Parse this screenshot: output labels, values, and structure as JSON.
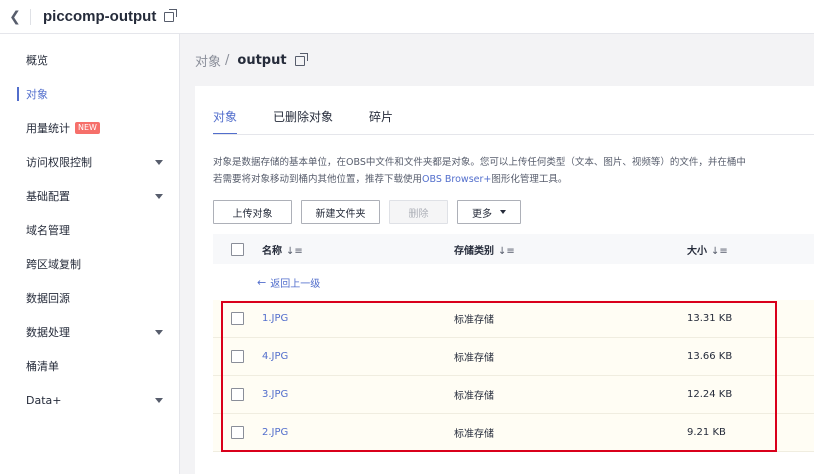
{
  "header": {
    "back_icon": "chevron-left-icon",
    "bucket_name": "piccomp-output",
    "copy_icon": "copy-icon"
  },
  "sidebar": {
    "items": [
      {
        "label": "概览"
      },
      {
        "label": "对象",
        "active": true
      },
      {
        "label": "用量统计",
        "badge": "NEW"
      },
      {
        "label": "访问权限控制",
        "has_submenu": true
      },
      {
        "label": "基础配置",
        "has_submenu": true
      },
      {
        "label": "域名管理"
      },
      {
        "label": "跨区域复制"
      },
      {
        "label": "数据回源"
      },
      {
        "label": "数据处理",
        "has_submenu": true
      },
      {
        "label": "桶清单"
      },
      {
        "label": "Data+",
        "has_submenu": true
      }
    ]
  },
  "breadcrumb": {
    "root": "对象",
    "separator": "/",
    "current": "output"
  },
  "tabs": [
    {
      "label": "对象",
      "active": true
    },
    {
      "label": "已删除对象"
    },
    {
      "label": "碎片"
    }
  ],
  "description": {
    "line1": "对象是数据存储的基本单位，在OBS中文件和文件夹都是对象。您可以上传任何类型（文本、图片、视频等）的文件，并在桶中",
    "line2_prefix": "若需要将对象移动到桶内其他位置，推荐下载使用",
    "line2_link": "OBS Browser+",
    "line2_suffix": "图形化管理工具。"
  },
  "toolbar": {
    "upload": "上传对象",
    "new_folder": "新建文件夹",
    "delete": "删除",
    "more": "更多"
  },
  "table": {
    "headers": {
      "name": "名称",
      "storage_class": "存储类别",
      "size": "大小",
      "sort_icon": "sort-icon"
    },
    "back_link": "返回上一级",
    "rows": [
      {
        "name": "1.JPG",
        "storage_class": "标准存储",
        "size": "13.31 KB"
      },
      {
        "name": "4.JPG",
        "storage_class": "标准存储",
        "size": "13.66 KB"
      },
      {
        "name": "3.JPG",
        "storage_class": "标准存储",
        "size": "12.24 KB"
      },
      {
        "name": "2.JPG",
        "storage_class": "标准存储",
        "size": "9.21 KB"
      }
    ]
  },
  "colors": {
    "accent": "#526ecc",
    "highlight": "#d9001b",
    "new_badge": "#f66f6a"
  }
}
